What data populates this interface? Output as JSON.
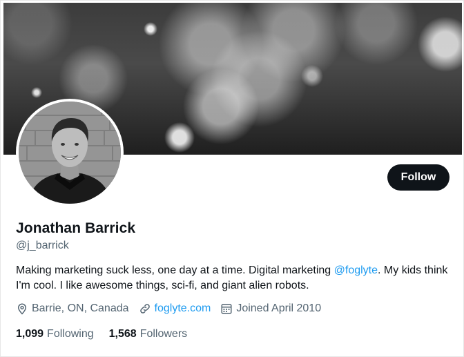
{
  "profile": {
    "name": "Jonathan Barrick",
    "handle": "@j_barrick",
    "follow_label": "Follow",
    "bio": {
      "before": "Making marketing suck less, one day at a time. Digital marketing ",
      "mention": "@foglyte",
      "after": ". My kids think I'm cool. I like awesome things, sci-fi, and giant alien robots."
    },
    "location": "Barrie, ON, Canada",
    "website": "foglyte.com",
    "joined": "Joined April 2010",
    "following_count": "1,099",
    "following_label": "Following",
    "followers_count": "1,568",
    "followers_label": "Followers"
  },
  "icons": {
    "location": "location-pin-icon",
    "website": "link-icon",
    "joined": "calendar-icon"
  },
  "colors": {
    "link": "#1d9bf0",
    "text_primary": "#0f1419",
    "text_secondary": "#536471",
    "button_bg": "#0f1419"
  }
}
